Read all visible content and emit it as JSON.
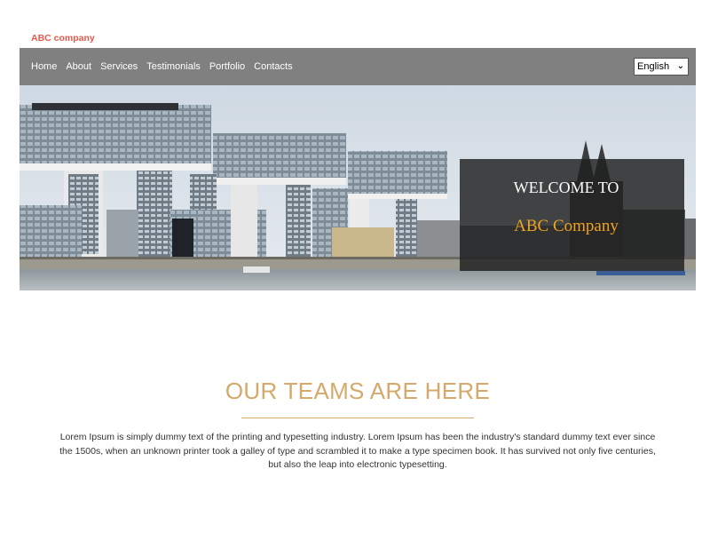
{
  "brand": {
    "name": "ABC company"
  },
  "nav": {
    "items": [
      {
        "label": "Home"
      },
      {
        "label": "About"
      },
      {
        "label": "Services"
      },
      {
        "label": "Testimonials"
      },
      {
        "label": "Portfolio"
      },
      {
        "label": "Contacts"
      }
    ],
    "language": {
      "selected": "English"
    }
  },
  "hero": {
    "welcome_line1": "WELCOME TO",
    "welcome_line2": "ABC Company"
  },
  "teams": {
    "heading": "OUR TEAMS ARE HERE",
    "body": "Lorem Ipsum is simply dummy text of the printing and typesetting industry. Lorem Ipsum has been the industry's standard dummy text ever since the 1500s, when an unknown printer took a galley of type and scrambled it to make a type specimen book. It has survived not only five centuries, but also the leap into electronic typesetting."
  },
  "colors": {
    "brand": "#e8584a",
    "nav_bg": "#808080",
    "accent_gold": "#d4a96b",
    "welcome_orange": "#f0a41e"
  }
}
